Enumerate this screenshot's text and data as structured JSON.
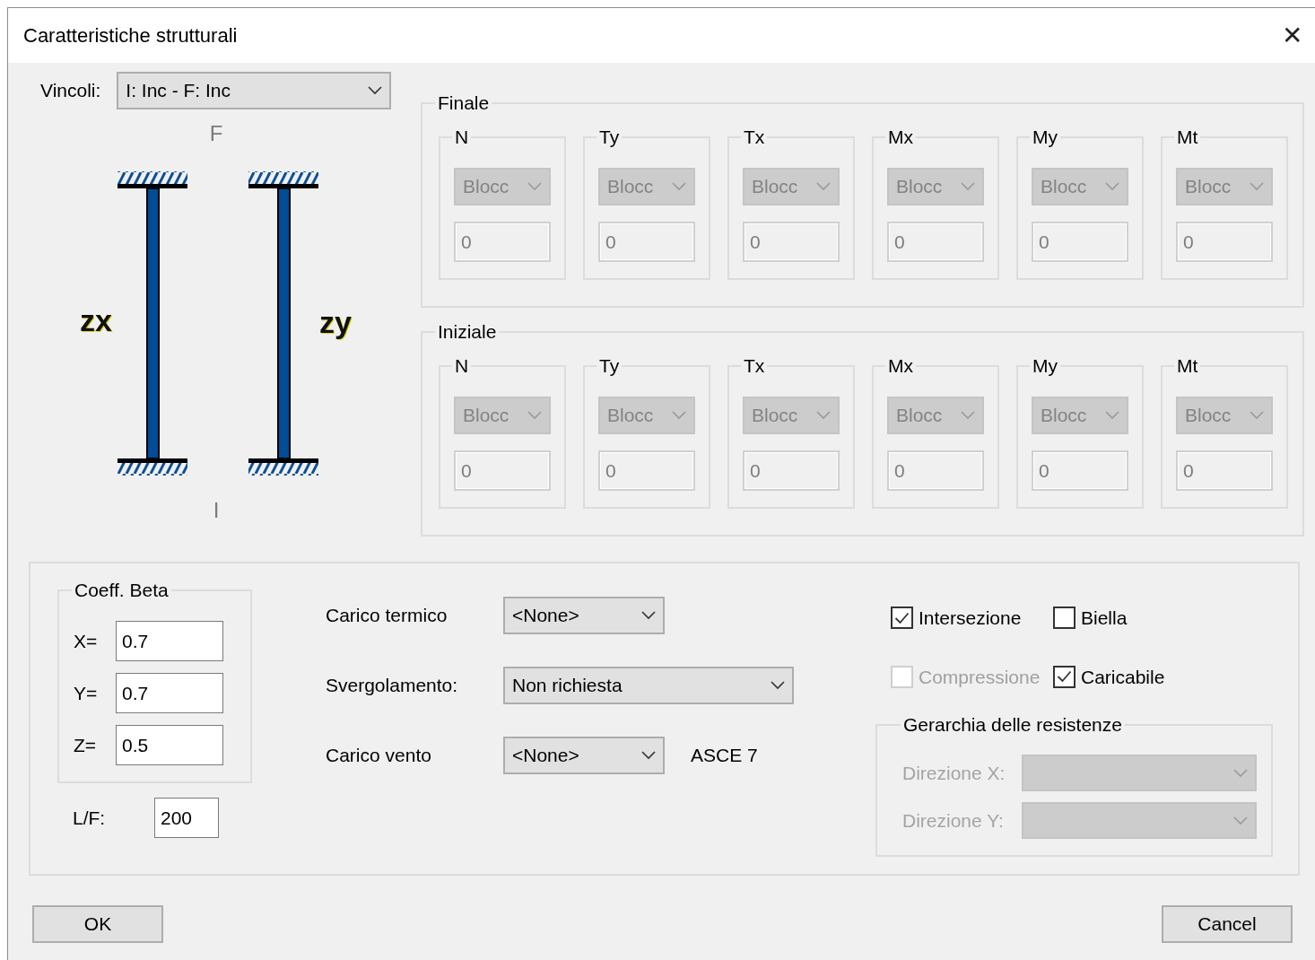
{
  "window": {
    "title": "Caratteristiche strutturali",
    "close": "✕"
  },
  "vincoli": {
    "label": "Vincoli:",
    "value": "I: Inc - F: Inc"
  },
  "diagram": {
    "top_label": "F",
    "bottom_label": "I",
    "left_label": "zx",
    "right_label": "zy"
  },
  "groups": [
    {
      "title": "Finale",
      "components": [
        {
          "label": "N",
          "mode": "Blocc",
          "value": "0",
          "disabled": true
        },
        {
          "label": "Ty",
          "mode": "Blocc",
          "value": "0",
          "disabled": true
        },
        {
          "label": "Tx",
          "mode": "Blocc",
          "value": "0",
          "disabled": true
        },
        {
          "label": "Mx",
          "mode": "Blocc",
          "value": "0",
          "disabled": true
        },
        {
          "label": "My",
          "mode": "Blocc",
          "value": "0",
          "disabled": true
        },
        {
          "label": "Mt",
          "mode": "Blocc",
          "value": "0",
          "disabled": true
        }
      ]
    },
    {
      "title": "Iniziale",
      "components": [
        {
          "label": "N",
          "mode": "Blocc",
          "value": "0",
          "disabled": true
        },
        {
          "label": "Ty",
          "mode": "Blocc",
          "value": "0",
          "disabled": true
        },
        {
          "label": "Tx",
          "mode": "Blocc",
          "value": "0",
          "disabled": true
        },
        {
          "label": "Mx",
          "mode": "Blocc",
          "value": "0",
          "disabled": true
        },
        {
          "label": "My",
          "mode": "Blocc",
          "value": "0",
          "disabled": true
        },
        {
          "label": "Mt",
          "mode": "Blocc",
          "value": "0",
          "disabled": true
        }
      ]
    }
  ],
  "coeff_beta": {
    "title": "Coeff. Beta",
    "fields": [
      {
        "label": "X=",
        "value": "0.7"
      },
      {
        "label": "Y=",
        "value": "0.7"
      },
      {
        "label": "Z=",
        "value": "0.5"
      }
    ]
  },
  "lf": {
    "label": "L/F:",
    "value": "200"
  },
  "loads": [
    {
      "label": "Carico termico",
      "value": "<None>"
    },
    {
      "label": "Svergolamento:",
      "value": "Non richiesta"
    },
    {
      "label": "Carico vento",
      "value": "<None>",
      "note": "ASCE 7"
    }
  ],
  "checkboxes": [
    {
      "label": "Intersezione",
      "checked": true,
      "disabled": false
    },
    {
      "label": "Biella",
      "checked": false,
      "disabled": false
    },
    {
      "label": "Compressione",
      "checked": false,
      "disabled": true
    },
    {
      "label": "Caricabile",
      "checked": true,
      "disabled": false
    }
  ],
  "gerarchia": {
    "title": "Gerarchia delle resistenze",
    "disabled": true,
    "rows": [
      {
        "label": "Direzione X:"
      },
      {
        "label": "Direzione Y:"
      }
    ]
  },
  "buttons": [
    {
      "label": "OK"
    },
    {
      "label": "Cancel"
    }
  ]
}
